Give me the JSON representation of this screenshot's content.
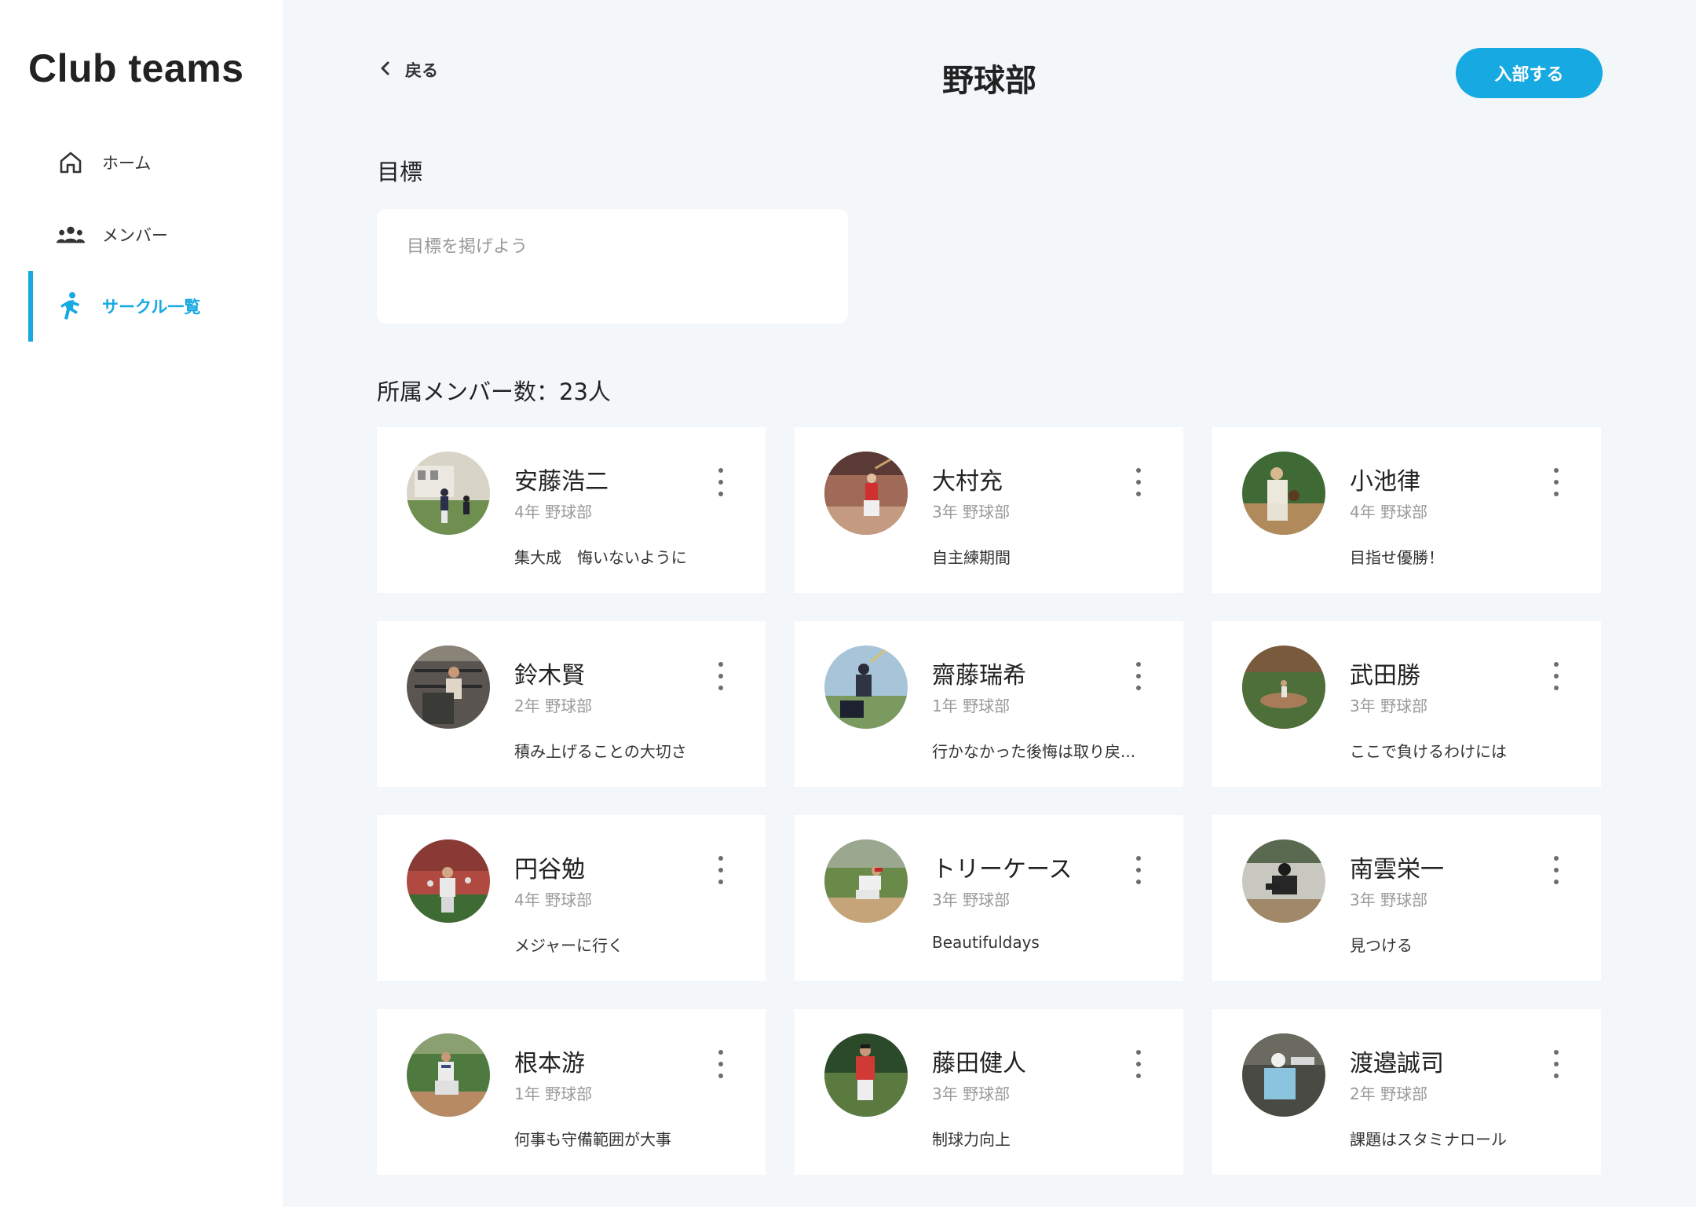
{
  "sidebar": {
    "brand": "Club teams",
    "items": [
      {
        "label": "ホーム",
        "icon": "home-icon"
      },
      {
        "label": "メンバー",
        "icon": "members-icon"
      },
      {
        "label": "サークル一覧",
        "icon": "runner-icon",
        "active": true
      }
    ]
  },
  "header": {
    "back_label": "戻る",
    "title": "野球部",
    "join_label": "入部する"
  },
  "goal": {
    "heading": "目標",
    "placeholder": "目標を掲げよう"
  },
  "members": {
    "heading": "所属メンバー数：23人",
    "list": [
      {
        "name": "安藤浩二",
        "meta": "4年 野球部",
        "message": "集大成　悔いないように"
      },
      {
        "name": "大村充",
        "meta": "3年 野球部",
        "message": "自主練期間"
      },
      {
        "name": "小池律",
        "meta": "4年 野球部",
        "message": "目指せ優勝！"
      },
      {
        "name": "鈴木賢",
        "meta": "2年 野球部",
        "message": "積み上げることの大切さ"
      },
      {
        "name": "齋藤瑞希",
        "meta": "1年 野球部",
        "message": "行かなかった後悔は取り戻..."
      },
      {
        "name": "武田勝",
        "meta": "3年 野球部",
        "message": "ここで負けるわけには"
      },
      {
        "name": "円谷勉",
        "meta": "4年 野球部",
        "message": "メジャーに行く"
      },
      {
        "name": "トリーケース",
        "meta": "3年 野球部",
        "message": "Beautifuldays"
      },
      {
        "name": "南雲栄一",
        "meta": "3年 野球部",
        "message": "見つける"
      },
      {
        "name": "根本游",
        "meta": "1年 野球部",
        "message": "何事も守備範囲が大事"
      },
      {
        "name": "藤田健人",
        "meta": "3年 野球部",
        "message": "制球力向上"
      },
      {
        "name": "渡邉誠司",
        "meta": "2年 野球部",
        "message": "課題はスタミナロール"
      }
    ]
  },
  "colors": {
    "accent": "#17a9e1",
    "background": "#f4f7fa",
    "card": "#ffffff"
  }
}
